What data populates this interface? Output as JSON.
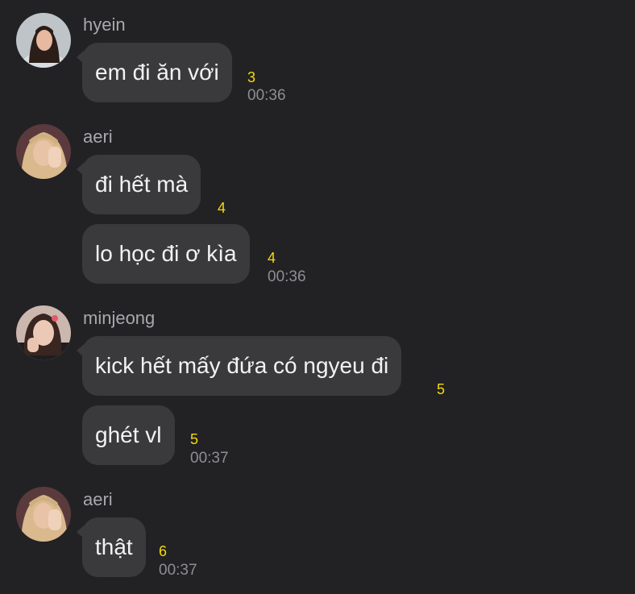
{
  "messages": [
    {
      "sender": "hyein",
      "avatar": "hyein-avatar",
      "lines": [
        {
          "text": "em đi ăn với",
          "unread": "3",
          "time": "00:36"
        }
      ]
    },
    {
      "sender": "aeri",
      "avatar": "aeri-avatar",
      "lines": [
        {
          "text": "đi hết mà",
          "unread": "4",
          "time": ""
        },
        {
          "text": "lo học đi ơ kìa",
          "unread": "4",
          "time": "00:36"
        }
      ]
    },
    {
      "sender": "minjeong",
      "avatar": "minjeong-avatar",
      "lines": [
        {
          "text": "kick hết mấy đứa có ngyeu đi",
          "unread": "5",
          "time": ""
        },
        {
          "text": "ghét vl",
          "unread": "5",
          "time": "00:37"
        }
      ]
    },
    {
      "sender": "aeri",
      "avatar": "aeri-avatar",
      "lines": [
        {
          "text": "thật",
          "unread": "6",
          "time": "00:37"
        }
      ]
    }
  ],
  "colors": {
    "background": "#222224",
    "bubble": "#3a3a3c",
    "message_text": "#f2f2f2",
    "sender_name": "#a8a8ad",
    "unread_count": "#f5d90a",
    "timestamp": "#8e8e93"
  }
}
